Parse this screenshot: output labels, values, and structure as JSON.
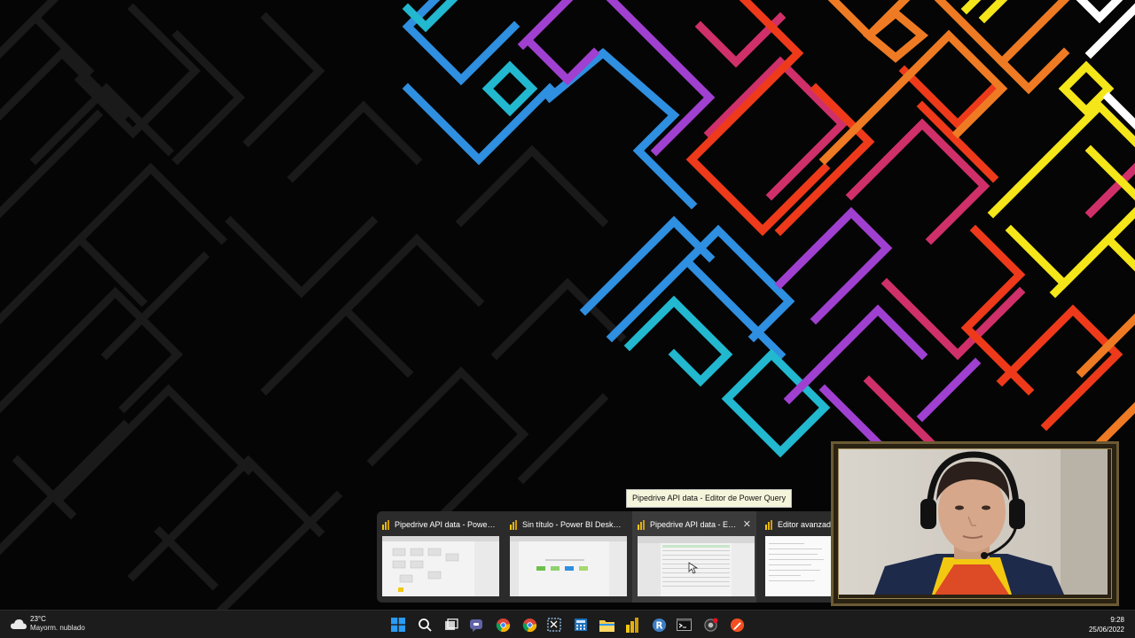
{
  "tooltip": {
    "text": "Pipedrive API data - Editor de Power Query"
  },
  "thumbnails": [
    {
      "title": "Pipedrive API data - Power BI ...",
      "active": false
    },
    {
      "title": "Sin título - Power BI Desktop",
      "active": false
    },
    {
      "title": "Pipedrive API data - Edit...",
      "active": true
    },
    {
      "title": "Editor avanzado",
      "active": false
    }
  ],
  "weather": {
    "temperature": "23°C",
    "description": "Mayorm. nublado"
  },
  "clock": {
    "time": "9:28",
    "date": "25/06/2022"
  },
  "taskbar_icons": [
    "windows-start-icon",
    "search-icon",
    "task-view-icon",
    "teams-chat-icon",
    "chrome-icon",
    "chrome-alt-icon",
    "snipping-tool-icon",
    "calculator-icon",
    "file-explorer-icon",
    "power-bi-icon",
    "r-icon",
    "terminal-icon",
    "recorder-icon",
    "pen-tool-icon"
  ],
  "colors": {
    "accent_blue": "#0078d4",
    "powerbi_yellow": "#f2c811",
    "maze_blue": "#2f8fe0",
    "maze_cyan": "#22b8d0",
    "maze_purple": "#a040d0",
    "maze_magenta": "#d0306a",
    "maze_red": "#ee3a1a",
    "maze_orange": "#ee7b24",
    "maze_yellow": "#f5e61a"
  }
}
